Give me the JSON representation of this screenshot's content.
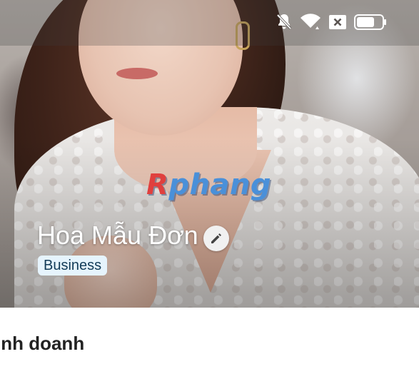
{
  "status_bar": {
    "icons": [
      "notifications-off-icon",
      "wifi-icon",
      "sim-error-icon",
      "battery-icon"
    ],
    "battery_level": 0.7
  },
  "cover": {
    "watermark_first": "R",
    "watermark_rest": "phang"
  },
  "profile": {
    "name": "Hoa Mẫu Đơn",
    "badge": "Business",
    "edit_icon": "pencil-icon"
  },
  "section": {
    "title": "inh doanh"
  },
  "colors": {
    "badge_bg": "#e6f4fd",
    "badge_text": "#123b57",
    "watermark_red": "#e0403e",
    "watermark_blue": "#4a90d9"
  }
}
